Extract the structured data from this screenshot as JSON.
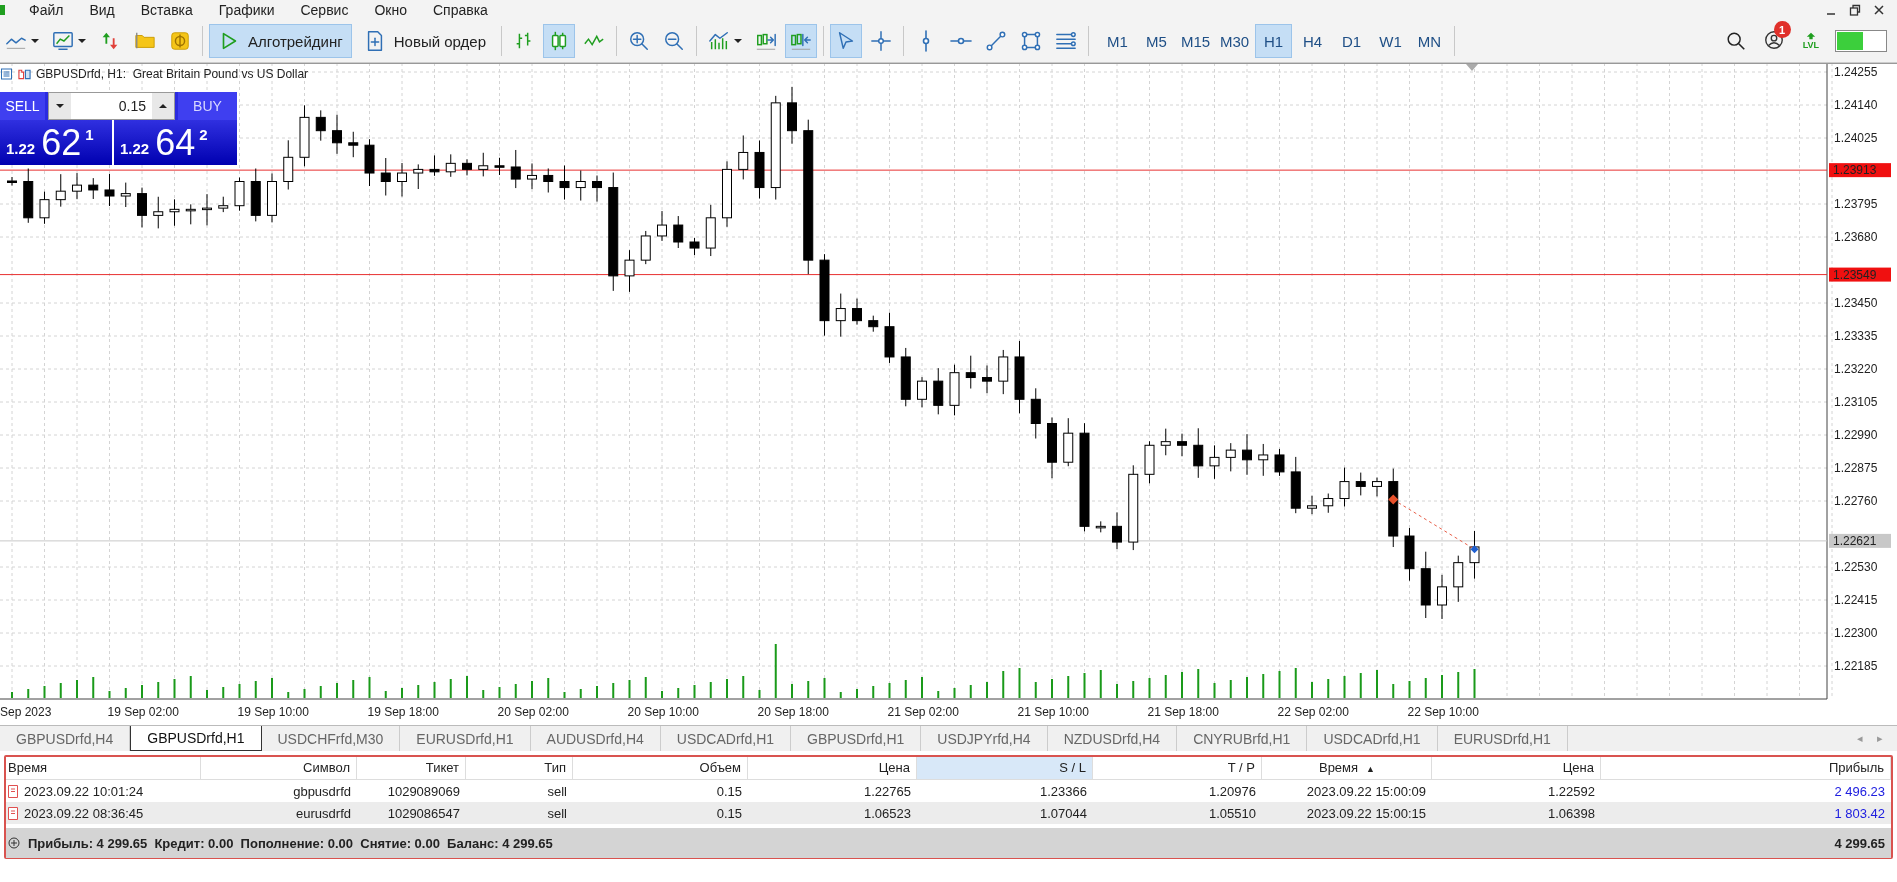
{
  "menu": {
    "items": [
      "Файл",
      "Вид",
      "Вставка",
      "Графики",
      "Сервис",
      "Окно",
      "Справка"
    ]
  },
  "toolbar": {
    "groups": [
      [
        {
          "kind": "line-chart",
          "dropdown": true,
          "selected": false
        },
        {
          "kind": "chart-window",
          "dropdown": true,
          "selected": false
        },
        {
          "kind": "arrows",
          "selected": false
        },
        {
          "kind": "folder",
          "selected": false
        },
        {
          "kind": "coin",
          "selected": false
        }
      ],
      [
        {
          "kind": "algo-trading",
          "label": "Алготрейдинг",
          "selected": true
        },
        {
          "kind": "new-order",
          "label": "Новый ордер",
          "selected": false
        }
      ],
      [
        {
          "kind": "bars",
          "selected": false
        },
        {
          "kind": "candles",
          "selected": true
        },
        {
          "kind": "zigzag",
          "selected": false
        }
      ],
      [
        {
          "kind": "zoom-in",
          "selected": false
        },
        {
          "kind": "zoom-out",
          "selected": false
        }
      ],
      [
        {
          "kind": "indicators",
          "dropdown": true,
          "selected": false
        },
        {
          "kind": "chart-shift",
          "selected": false
        },
        {
          "kind": "autoscroll",
          "selected": true
        }
      ],
      [
        {
          "kind": "cursor",
          "selected": true
        },
        {
          "kind": "crosshair",
          "selected": false
        }
      ],
      [
        {
          "kind": "vertical-line",
          "selected": false
        },
        {
          "kind": "horizontal-line",
          "selected": false
        },
        {
          "kind": "trend-line",
          "selected": false
        },
        {
          "kind": "rectangle",
          "selected": false
        },
        {
          "kind": "lines",
          "selected": false
        }
      ]
    ],
    "timeframes": [
      {
        "label": "M1",
        "selected": false
      },
      {
        "label": "M5",
        "selected": false
      },
      {
        "label": "M15",
        "selected": false
      },
      {
        "label": "M30",
        "selected": false
      },
      {
        "label": "H1",
        "selected": true
      },
      {
        "label": "H4",
        "selected": false
      },
      {
        "label": "D1",
        "selected": false
      },
      {
        "label": "W1",
        "selected": false
      },
      {
        "label": "MN",
        "selected": false
      }
    ],
    "notifications_badge": "1",
    "level_label": "LVL"
  },
  "chart": {
    "title": "GBPUSDrfd, H1:  Great Britain Pound vs US Dollar",
    "one_click": {
      "sell_label": "SELL",
      "buy_label": "BUY",
      "lot": "0.15",
      "sell_price": {
        "prefix": "1.22",
        "big": "62",
        "point": "1"
      },
      "buy_price": {
        "prefix": "1.22",
        "big": "64",
        "point": "2"
      }
    },
    "price_ticks": [
      "1.24255",
      "1.24140",
      "1.24025",
      "1.23795",
      "1.23680",
      "1.23450",
      "1.23335",
      "1.23220",
      "1.23105",
      "1.22990",
      "1.22875",
      "1.22760",
      "1.22530",
      "1.22415",
      "1.22300",
      "1.22185"
    ],
    "price_markers": [
      {
        "price": "1.23913",
        "kind": "level"
      },
      {
        "price": "1.23549",
        "kind": "level"
      },
      {
        "price": "1.22621",
        "kind": "bid"
      }
    ],
    "time_labels": [
      "Sep 2023",
      "19 Sep 02:00",
      "19 Sep 10:00",
      "19 Sep 18:00",
      "20 Sep 02:00",
      "20 Sep 10:00",
      "20 Sep 18:00",
      "21 Sep 02:00",
      "21 Sep 10:00",
      "21 Sep 18:00",
      "22 Sep 02:00",
      "22 Sep 10:00"
    ]
  },
  "chart_tabs": [
    {
      "label": "GBPUSDrfd,H4",
      "selected": false
    },
    {
      "label": "GBPUSDrfd,H1",
      "selected": true
    },
    {
      "label": "USDCHFrfd,M30",
      "selected": false
    },
    {
      "label": "EURUSDrfd,H1",
      "selected": false
    },
    {
      "label": "AUDUSDrfd,H4",
      "selected": false
    },
    {
      "label": "USDCADrfd,H1",
      "selected": false
    },
    {
      "label": "GBPUSDrfd,H1",
      "selected": false
    },
    {
      "label": "USDJPYrfd,H4",
      "selected": false
    },
    {
      "label": "NZDUSDrfd,H4",
      "selected": false
    },
    {
      "label": "CNYRUBrfd,H1",
      "selected": false
    },
    {
      "label": "USDCADrfd,H1",
      "selected": false
    },
    {
      "label": "EURUSDrfd,H1",
      "selected": false
    }
  ],
  "tab_scroll": [
    "◂",
    "▸"
  ],
  "table": {
    "columns": [
      {
        "label": "Время",
        "highlighted": false
      },
      {
        "label": "Символ",
        "highlighted": false
      },
      {
        "label": "Тикет",
        "highlighted": false
      },
      {
        "label": "Тип",
        "highlighted": false
      },
      {
        "label": "Объем",
        "highlighted": false
      },
      {
        "label": "Цена",
        "highlighted": false
      },
      {
        "label": "S / L",
        "highlighted": true
      },
      {
        "label": "T / P",
        "highlighted": false
      },
      {
        "label": "Время",
        "highlighted": false,
        "sort_mark": "▲"
      },
      {
        "label": "Цена",
        "highlighted": false
      },
      {
        "label": "Прибыль",
        "highlighted": false
      }
    ],
    "rows": [
      [
        "2023.09.22 10:01:24",
        "gbpusdrfd",
        "1029089069",
        "sell",
        "0.15",
        "1.22765",
        "1.23366",
        "1.20976",
        "2023.09.22 15:00:09",
        "1.22592",
        "2 496.23"
      ],
      [
        "2023.09.22 08:36:45",
        "eurusdrfd",
        "1029086547",
        "sell",
        "0.15",
        "1.06523",
        "1.07044",
        "1.05510",
        "2023.09.22 15:00:15",
        "1.06398",
        "1 803.42"
      ]
    ],
    "summary": "Прибыль: 4 299.65  Кредит: 0.00  Пополнение: 0.00  Снятие: 0.00  Баланс: 4 299.65",
    "total": "4 299.65"
  }
}
